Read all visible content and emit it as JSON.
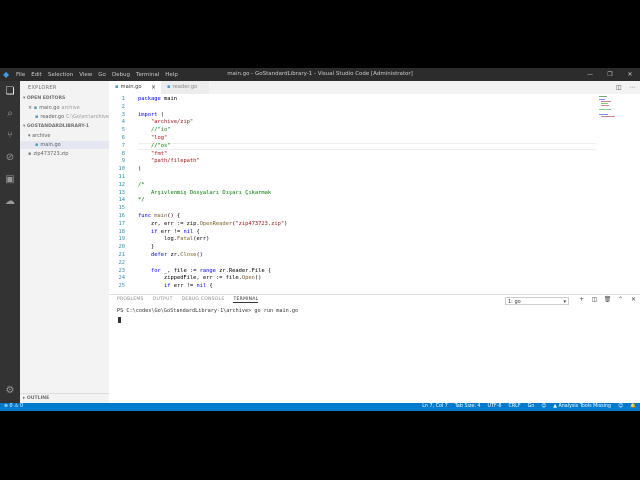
{
  "window": {
    "title": "main.go - GoStandardLibrary-1 - Visual Studio Code [Administrator]",
    "menu": [
      "File",
      "Edit",
      "Selection",
      "View",
      "Go",
      "Debug",
      "Terminal",
      "Help"
    ]
  },
  "sidebar": {
    "header": "EXPLORER",
    "open_editors_label": "OPEN EDITORS",
    "open_editors": [
      {
        "name": "main.go",
        "hint": "archive",
        "close": "×"
      },
      {
        "name": "reader.go",
        "hint": "C:\\Go\\src\\archive..."
      }
    ],
    "folder_label": "GOSTANDARDLIBRARY-1",
    "tree": [
      {
        "name": "archive"
      },
      {
        "name": "main.go"
      },
      {
        "name": "zip473723.zip"
      }
    ],
    "outline_label": "OUTLINE"
  },
  "tabs": [
    {
      "label": "main.go"
    },
    {
      "label": "reader.go"
    }
  ],
  "editor": {
    "lines": [
      {
        "n": "1",
        "html": "<span class=\"kw\">package</span> main"
      },
      {
        "n": "2",
        "html": ""
      },
      {
        "n": "3",
        "html": "<span class=\"kw\">import</span> ("
      },
      {
        "n": "4",
        "html": "    <span class=\"str\">\"archive/zip\"</span>"
      },
      {
        "n": "5",
        "html": "    <span class=\"com\">//\"io\"</span>"
      },
      {
        "n": "6",
        "html": "    <span class=\"str\">\"log\"</span>"
      },
      {
        "n": "7",
        "html": "    <span class=\"com\">//\"os\"</span>"
      },
      {
        "n": "8",
        "html": "    <span class=\"str\">\"fmt\"</span>"
      },
      {
        "n": "9",
        "html": "    <span class=\"str\">\"path/filepath\"</span>"
      },
      {
        "n": "10",
        "html": ")"
      },
      {
        "n": "11",
        "html": ""
      },
      {
        "n": "12",
        "html": "<span class=\"com\">/*</span>"
      },
      {
        "n": "13",
        "html": "<span class=\"com\">    Arşivlenmiş Dosyaları Dışarı Çıkarmak</span>"
      },
      {
        "n": "14",
        "html": "<span class=\"com\">*/</span>"
      },
      {
        "n": "15",
        "html": ""
      },
      {
        "n": "16",
        "html": "<span class=\"kw\">func</span> <span class=\"fn\">main</span>() {"
      },
      {
        "n": "17",
        "html": "    zr, err := zip.<span class=\"fn\">OpenReader</span>(<span class=\"str\">\"zip473723.zip\"</span>)"
      },
      {
        "n": "18",
        "html": "    <span class=\"kw\">if</span> err != <span class=\"kw\">nil</span> {"
      },
      {
        "n": "19",
        "html": "        log.<span class=\"fn\">Fatal</span>(err)"
      },
      {
        "n": "20",
        "html": "    }"
      },
      {
        "n": "21",
        "html": "    <span class=\"kw\">defer</span> zr.<span class=\"fn\">Close</span>()"
      },
      {
        "n": "22",
        "html": ""
      },
      {
        "n": "23",
        "html": "    <span class=\"kw\">for</span> _, file := <span class=\"kw\">range</span> zr.Reader.File {"
      },
      {
        "n": "24",
        "html": "        zippedFile, err := file.<span class=\"fn\">Open</span>()"
      },
      {
        "n": "25",
        "html": "        <span class=\"kw\">if</span> err != <span class=\"kw\">nil</span> {"
      }
    ]
  },
  "panel": {
    "tabs": [
      "PROBLEMS",
      "OUTPUT",
      "DEBUG CONSOLE",
      "TERMINAL"
    ],
    "terminal_select": "1: go",
    "terminal_line": "PS C:\\codes\\Go\\GoStandardLibrary-1\\archive> go run main.go"
  },
  "status": {
    "left": "⊗ 0 ⚠ 0",
    "items": [
      "Ln 7, Col 7",
      "Tab Size: 4",
      "UTF-8",
      "CRLF",
      "Go",
      "☺",
      "▲ Analysis Tools Missing",
      "☺",
      "🔔"
    ]
  }
}
